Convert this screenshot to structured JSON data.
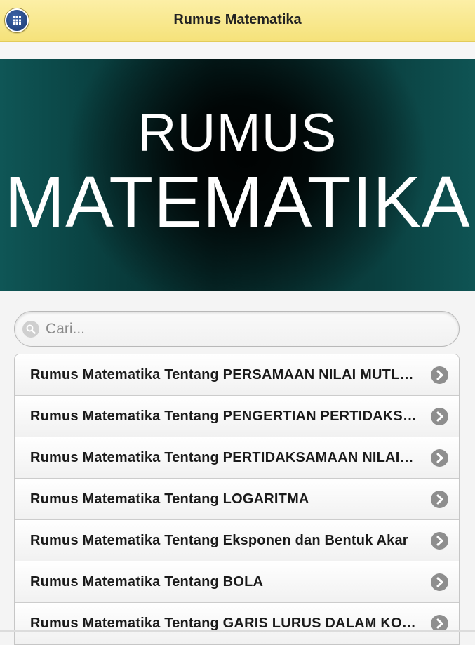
{
  "header": {
    "title": "Rumus Matematika",
    "menu_icon": "grid-menu-icon"
  },
  "banner": {
    "line1": "RUMUS",
    "line2": "MATEMATIKA"
  },
  "search": {
    "placeholder": "Cari...",
    "value": "",
    "icon": "search-icon"
  },
  "list": {
    "items": [
      {
        "label": "Rumus Matematika Tentang PERSAMAAN NILAI MUTLAK"
      },
      {
        "label": "Rumus Matematika Tentang PENGERTIAN PERTIDAKSAMAAN"
      },
      {
        "label": "Rumus Matematika Tentang PERTIDAKSAMAAN NILAI MUTLAK"
      },
      {
        "label": "Rumus Matematika Tentang LOGARITMA"
      },
      {
        "label": "Rumus Matematika Tentang Eksponen dan Bentuk Akar"
      },
      {
        "label": "Rumus Matematika Tentang BOLA"
      },
      {
        "label": "Rumus Matematika Tentang GARIS LURUS DALAM KOORDINAT"
      }
    ],
    "item_icon": "chevron-right-icon"
  },
  "colors": {
    "header_bg": "#f5e27a",
    "banner_bg": "#0a4343",
    "chevron": "#8e8e8e"
  }
}
